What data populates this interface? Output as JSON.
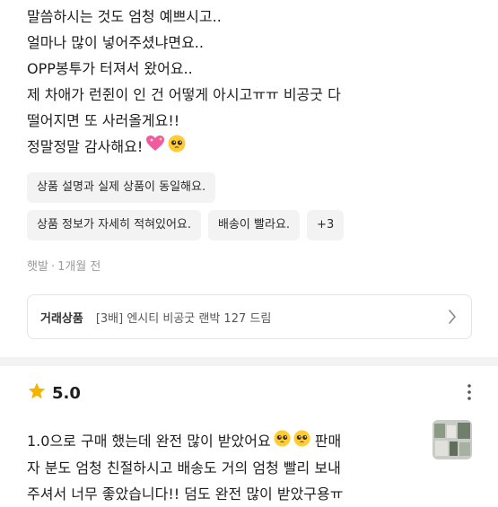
{
  "review1": {
    "lines": [
      "말씀하시는 것도 엄청 예쁘시고..",
      "얼마나 많이 넣어주셨냐면요..",
      "OPP봉투가 터져서 왔어요..",
      "제 차애가 런쥔이 인 건 어떻게 아시고ㅠㅠ 비공굿 다",
      "떨어지면 또 사러올게요!!",
      "정말정말 감사해요!"
    ],
    "tags": [
      [
        "상품 설명과 실제 상품이 동일해요."
      ],
      [
        "상품 정보가 자세히 적혀있어요.",
        "배송이 빨라요.",
        "+3"
      ]
    ],
    "author": "햇발",
    "time": "1개월 전",
    "product": {
      "label": "거래상품",
      "name": "[3배] 엔시티 비공굿 랜박 127 드림"
    }
  },
  "review2": {
    "rating": "5.0",
    "lines": [
      "1.0으로 구매 했는데 완전 많이 받았어요",
      "자 분도 엄청 친절하시고 배송도 거의 엄청 빨리 보내",
      "주셔서 너무 좋았습니다!! 덤도 완전 많이 받았구용ㅠ"
    ],
    "line1_tail": "판매"
  },
  "colors": {
    "star": "#f5b400",
    "tag_bg": "#f3f3f3",
    "meta": "#9a9a9a"
  }
}
